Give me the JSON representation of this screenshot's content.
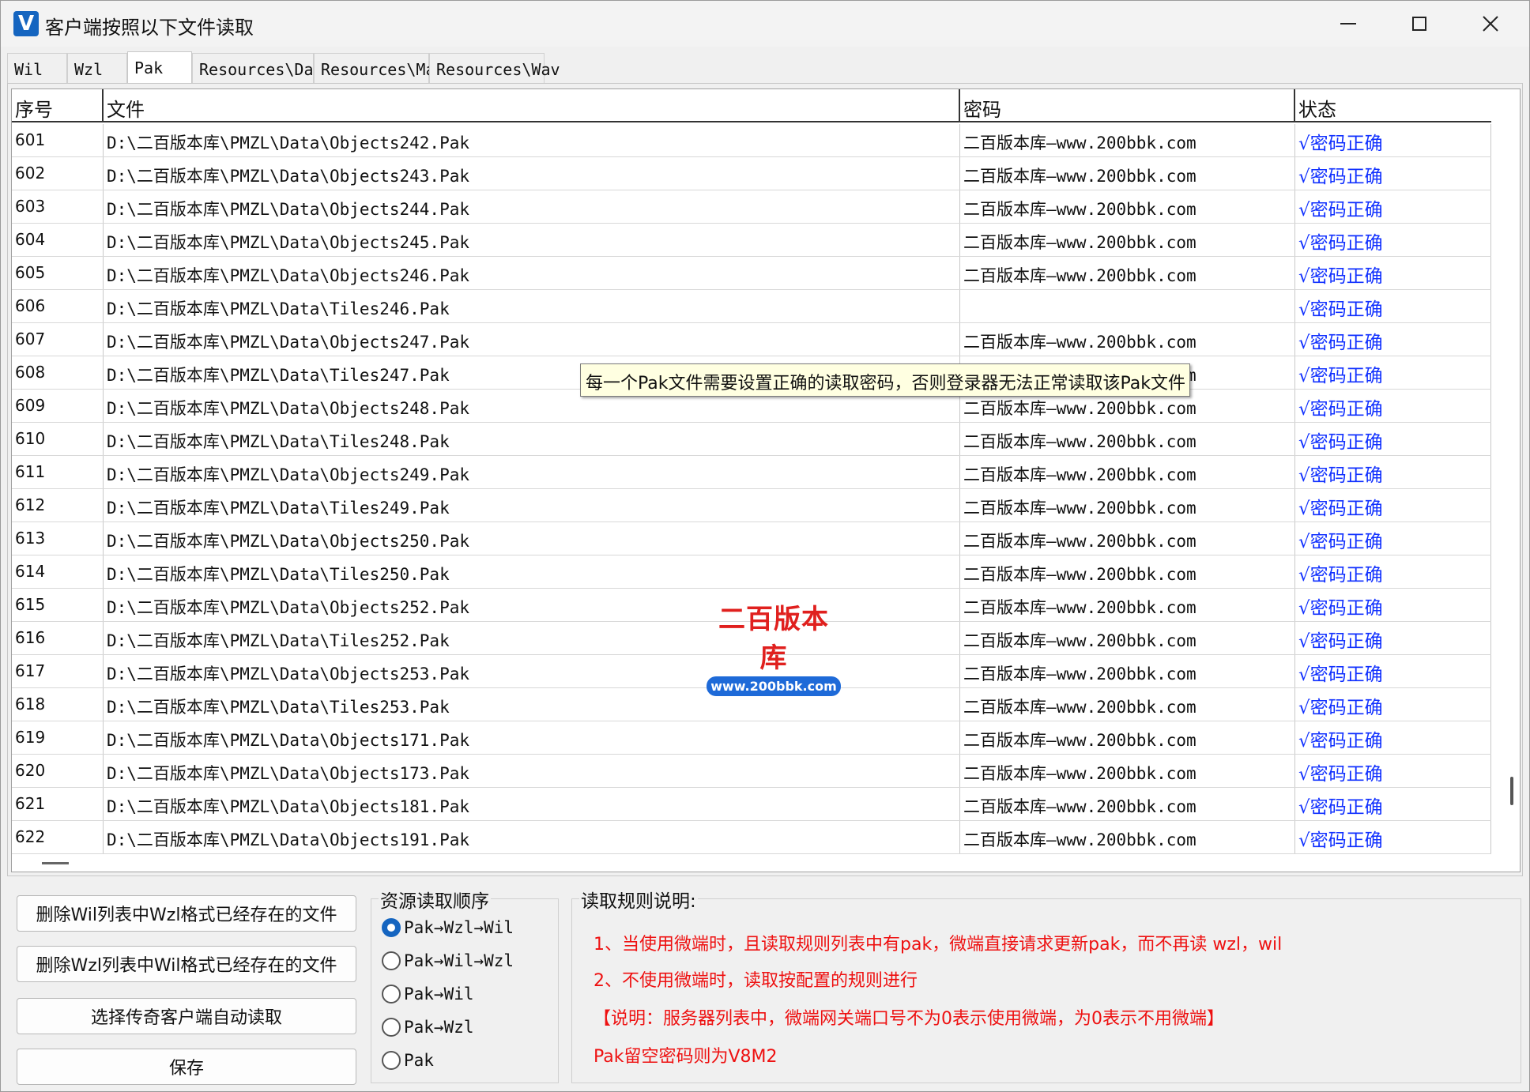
{
  "window": {
    "title": "客户端按照以下文件读取",
    "icon_letter": "V"
  },
  "tabs": [
    "Wil",
    "Wzl",
    "Pak",
    "Resources\\Data",
    "Resources\\Map",
    "Resources\\Wav"
  ],
  "active_tab": "Pak",
  "table": {
    "headers": [
      "序号",
      "文件",
      "密码",
      "状态"
    ],
    "rows": [
      {
        "no": "601",
        "file": "D:\\二百版本库\\PMZL\\Data\\Objects242.Pak",
        "pwd": "二百版本库—www.200bbk.com",
        "status": "√密码正确"
      },
      {
        "no": "602",
        "file": "D:\\二百版本库\\PMZL\\Data\\Objects243.Pak",
        "pwd": "二百版本库—www.200bbk.com",
        "status": "√密码正确"
      },
      {
        "no": "603",
        "file": "D:\\二百版本库\\PMZL\\Data\\Objects244.Pak",
        "pwd": "二百版本库—www.200bbk.com",
        "status": "√密码正确"
      },
      {
        "no": "604",
        "file": "D:\\二百版本库\\PMZL\\Data\\Objects245.Pak",
        "pwd": "二百版本库—www.200bbk.com",
        "status": "√密码正确"
      },
      {
        "no": "605",
        "file": "D:\\二百版本库\\PMZL\\Data\\Objects246.Pak",
        "pwd": "二百版本库—www.200bbk.com",
        "status": "√密码正确"
      },
      {
        "no": "606",
        "file": "D:\\二百版本库\\PMZL\\Data\\Tiles246.Pak",
        "pwd": "",
        "status": "√密码正确"
      },
      {
        "no": "607",
        "file": "D:\\二百版本库\\PMZL\\Data\\Objects247.Pak",
        "pwd": "二百版本库—www.200bbk.com",
        "status": "√密码正确"
      },
      {
        "no": "608",
        "file": "D:\\二百版本库\\PMZL\\Data\\Tiles247.Pak",
        "pwd": "二百版本库—www.200bbk.com",
        "status": "√密码正确"
      },
      {
        "no": "609",
        "file": "D:\\二百版本库\\PMZL\\Data\\Objects248.Pak",
        "pwd": "二百版本库—www.200bbk.com",
        "status": "√密码正确"
      },
      {
        "no": "610",
        "file": "D:\\二百版本库\\PMZL\\Data\\Tiles248.Pak",
        "pwd": "二百版本库—www.200bbk.com",
        "status": "√密码正确"
      },
      {
        "no": "611",
        "file": "D:\\二百版本库\\PMZL\\Data\\Objects249.Pak",
        "pwd": "二百版本库—www.200bbk.com",
        "status": "√密码正确"
      },
      {
        "no": "612",
        "file": "D:\\二百版本库\\PMZL\\Data\\Tiles249.Pak",
        "pwd": "二百版本库—www.200bbk.com",
        "status": "√密码正确"
      },
      {
        "no": "613",
        "file": "D:\\二百版本库\\PMZL\\Data\\Objects250.Pak",
        "pwd": "二百版本库—www.200bbk.com",
        "status": "√密码正确"
      },
      {
        "no": "614",
        "file": "D:\\二百版本库\\PMZL\\Data\\Tiles250.Pak",
        "pwd": "二百版本库—www.200bbk.com",
        "status": "√密码正确"
      },
      {
        "no": "615",
        "file": "D:\\二百版本库\\PMZL\\Data\\Objects252.Pak",
        "pwd": "二百版本库—www.200bbk.com",
        "status": "√密码正确"
      },
      {
        "no": "616",
        "file": "D:\\二百版本库\\PMZL\\Data\\Tiles252.Pak",
        "pwd": "二百版本库—www.200bbk.com",
        "status": "√密码正确"
      },
      {
        "no": "617",
        "file": "D:\\二百版本库\\PMZL\\Data\\Objects253.Pak",
        "pwd": "二百版本库—www.200bbk.com",
        "status": "√密码正确"
      },
      {
        "no": "618",
        "file": "D:\\二百版本库\\PMZL\\Data\\Tiles253.Pak",
        "pwd": "二百版本库—www.200bbk.com",
        "status": "√密码正确"
      },
      {
        "no": "619",
        "file": "D:\\二百版本库\\PMZL\\Data\\Objects171.Pak",
        "pwd": "二百版本库—www.200bbk.com",
        "status": "√密码正确"
      },
      {
        "no": "620",
        "file": "D:\\二百版本库\\PMZL\\Data\\Objects173.Pak",
        "pwd": "二百版本库—www.200bbk.com",
        "status": "√密码正确"
      },
      {
        "no": "621",
        "file": "D:\\二百版本库\\PMZL\\Data\\Objects181.Pak",
        "pwd": "二百版本库—www.200bbk.com",
        "status": "√密码正确"
      },
      {
        "no": "622",
        "file": "D:\\二百版本库\\PMZL\\Data\\Objects191.Pak",
        "pwd": "二百版本库—www.200bbk.com",
        "status": "√密码正确"
      }
    ]
  },
  "tooltip": "每一个Pak文件需要设置正确的读取密码，否则登录器无法正常读取该Pak文件",
  "watermark": {
    "title": "二百版本库",
    "url": "www.200bbk.com"
  },
  "buttons": {
    "delete_wil": "删除Wil列表中Wzl格式已经存在的文件",
    "delete_wzl": "删除Wzl列表中Wil格式已经存在的文件",
    "auto_read": "选择传奇客户端自动读取",
    "save": "保存"
  },
  "read_order": {
    "label": "资源读取顺序",
    "options": [
      "Pak→Wzl→Wil",
      "Pak→Wil→Wzl",
      "Pak→Wil",
      "Pak→Wzl",
      "Pak"
    ],
    "selected": "Pak→Wzl→Wil"
  },
  "rules": {
    "label": "读取规则说明:",
    "lines": [
      "1、当使用微端时，且读取规则列表中有pak，微端直接请求更新pak，而不再读 wzl，wil",
      "2、不使用微端时，读取按配置的规则进行",
      "【说明：服务器列表中，微端网关端口号不为0表示使用微端，为0表示不用微端】",
      "Pak留空密码则为V8M2"
    ],
    "color": "#e11111"
  },
  "colors": {
    "status_ok": "#1030ff",
    "accent": "#1565c0"
  }
}
